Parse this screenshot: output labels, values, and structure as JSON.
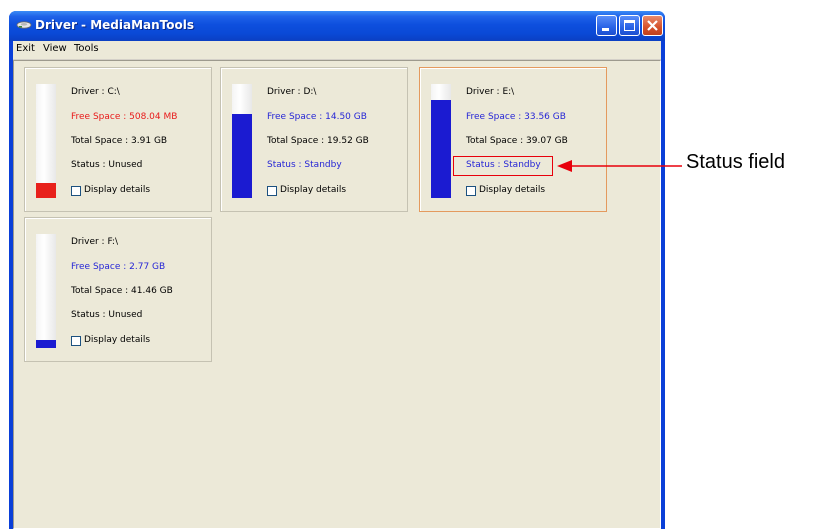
{
  "window": {
    "title": "Driver - MediaManTools",
    "icon": "drive-icon"
  },
  "menu": {
    "items": [
      "Exit",
      "View",
      "Tools"
    ]
  },
  "drives": [
    {
      "driver": "Driver : C:\\",
      "free": "Free Space : 508.04 MB",
      "total": "Total Space : 3.91 GB",
      "status": "Status : Unused",
      "details_label": "Display details",
      "details_checked": false,
      "fill_fraction": 0.13,
      "fill_color": "#e8211c",
      "free_color": "#e81a1a",
      "status_color": "#000000",
      "selected": false
    },
    {
      "driver": "Driver : D:\\",
      "free": "Free Space : 14.50 GB",
      "total": "Total Space : 19.52 GB",
      "status": "Status : Standby",
      "details_label": "Display details",
      "details_checked": false,
      "fill_fraction": 0.74,
      "fill_color": "#1b1bd1",
      "free_color": "#2626d6",
      "status_color": "#2626d6",
      "selected": false
    },
    {
      "driver": "Driver : E:\\",
      "free": "Free Space : 33.56 GB",
      "total": "Total Space : 39.07 GB",
      "status": "Status : Standby",
      "details_label": "Display details",
      "details_checked": false,
      "fill_fraction": 0.86,
      "fill_color": "#1b1bd1",
      "free_color": "#2626d6",
      "status_color": "#2626d6",
      "selected": true
    },
    {
      "driver": "Driver : F:\\",
      "free": "Free Space : 2.77 GB",
      "total": "Total Space : 41.46 GB",
      "status": "Status : Unused",
      "details_label": "Display details",
      "details_checked": false,
      "fill_fraction": 0.07,
      "fill_color": "#1b1bd1",
      "free_color": "#2626d6",
      "status_color": "#000000",
      "selected": false
    }
  ],
  "annotation": {
    "label": "Status field",
    "color": "#e8000b"
  }
}
